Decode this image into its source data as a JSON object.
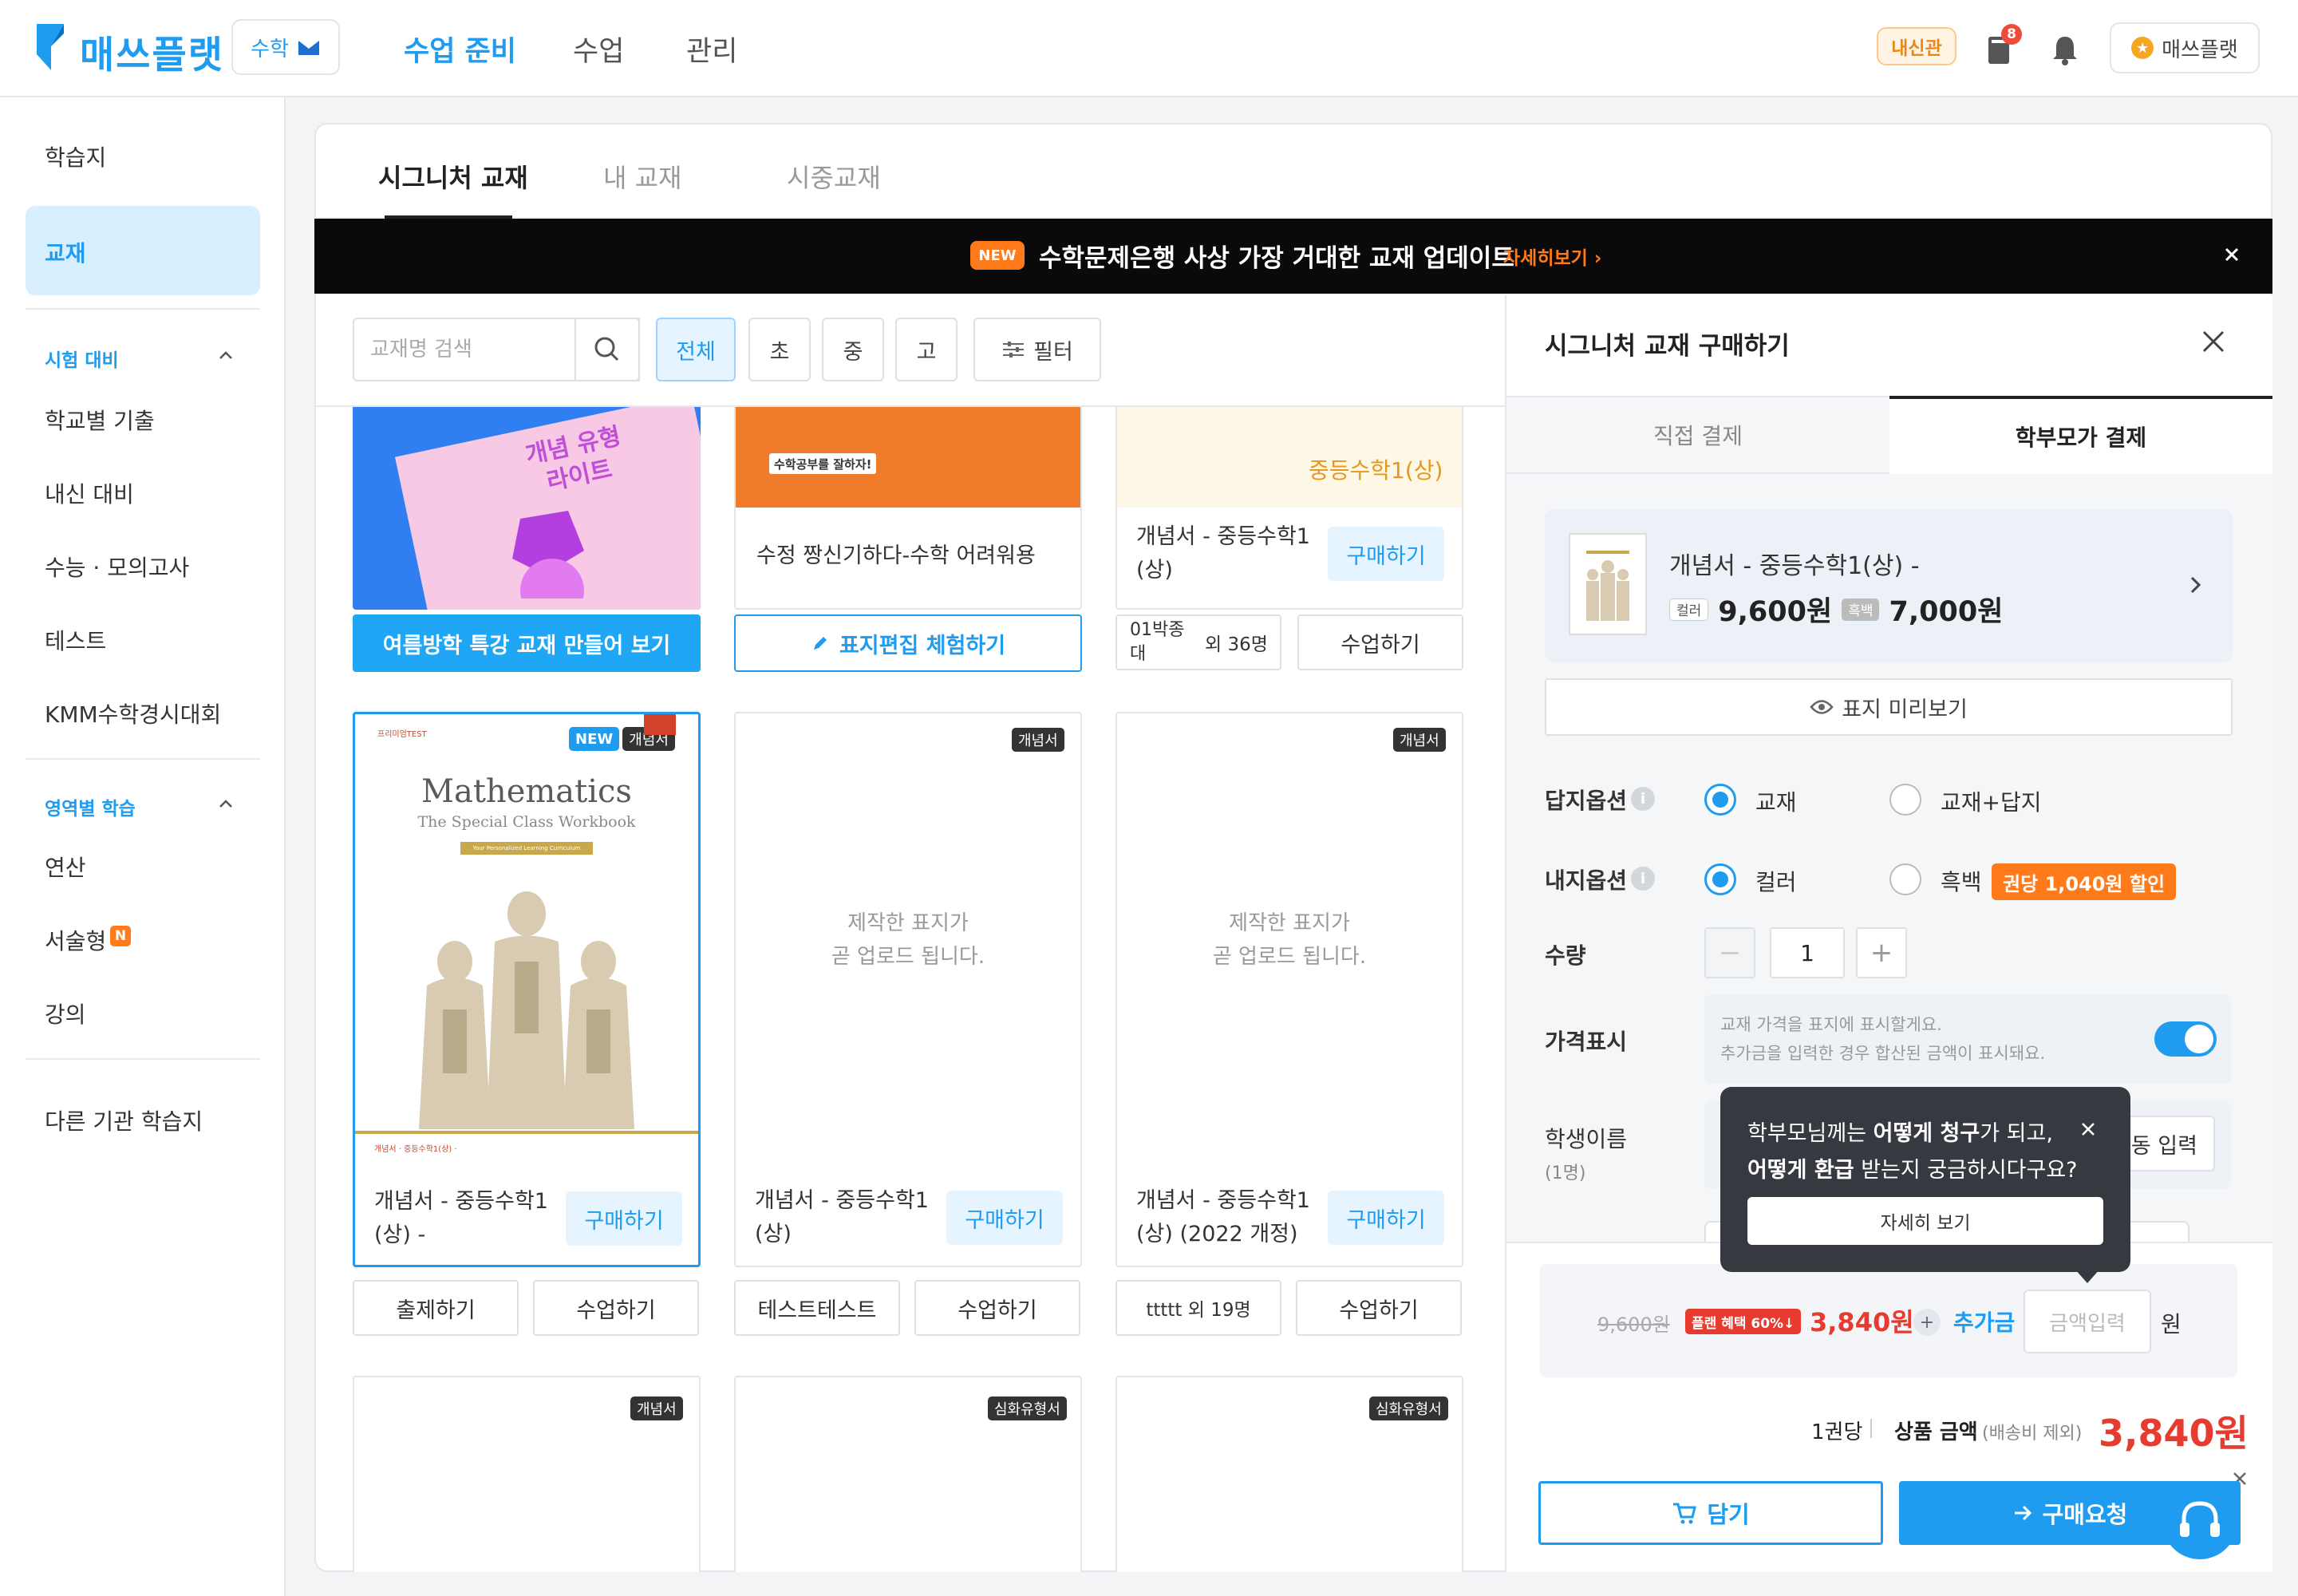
{
  "brand": {
    "logo_text": "매쓰플랫",
    "subject": "수학",
    "accent": "#1f9cf0"
  },
  "nav": {
    "items": [
      "수업 준비",
      "수업",
      "관리"
    ],
    "active": "수업 준비"
  },
  "header": {
    "org_badge": "내신관",
    "notif_count": "8",
    "user_label": "매쓰플랫"
  },
  "sidebar": {
    "items_top": [
      "학습지",
      "교재"
    ],
    "selected": "교재",
    "section_exam": "시험 대비",
    "exam_items": [
      "학교별 기출",
      "내신 대비",
      "수능 · 모의고사",
      "테스트",
      "KMM수학경시대회"
    ],
    "section_area": "영역별 학습",
    "area_items": [
      "연산",
      "서술형",
      "강의"
    ],
    "new_badge": "N",
    "bottom_item": "다른 기관 학습지"
  },
  "tabs": {
    "items": [
      "시그니처 교재",
      "내 교재",
      "시중교재"
    ],
    "active": "시그니처 교재"
  },
  "banner": {
    "badge": "NEW",
    "text": "수학문제은행 사상 가장 거대한 교재 업데이트",
    "link": "자세히보기"
  },
  "filters": {
    "search_placeholder": "교재명 검색",
    "levels": [
      "전체",
      "초",
      "중",
      "고"
    ],
    "active": "전체",
    "filter_label": "필터"
  },
  "top_row": {
    "card1_cover_text": "개념 유형\n라이트",
    "card1_button": "여름방학 특강 교재 만들어 보기",
    "card2_cover_tag": "수학공부를 잘하자!",
    "card2_title": "수정 짱신기하다-수학 어려워용",
    "card2_button": "표지편집 체험하기",
    "card3_cover_text": "중등수학1(상)",
    "card3_title": "개념서 - 중등수학1 (상)",
    "card3_buy": "구매하기",
    "card3_tag": "01박종대",
    "card3_count": "외 36명",
    "card3_class": "수업하기"
  },
  "cards": [
    {
      "tags": [
        "NEW",
        "개념서"
      ],
      "cover_small": "프리미엄TEST",
      "cover_title": "Mathematics",
      "cover_sub": "The Special Class Workbook",
      "cover_band": "Your Personalized Learning Curriculum",
      "cover_foot": "개념서 · 중등수학1(상) ·",
      "title": "개념서 - 중등수학1 (상) -",
      "buy": "구매하기",
      "btn_left": "출제하기",
      "btn_right": "수업하기"
    },
    {
      "tags": [
        "개념서"
      ],
      "placeholder": "제작한 표지가\n곧 업로드 됩니다.",
      "title": "개념서 - 중등수학1 (상)",
      "buy": "구매하기",
      "btn_left": "테스트테스트",
      "btn_right": "수업하기"
    },
    {
      "tags": [
        "개념서"
      ],
      "placeholder": "제작한 표지가\n곧 업로드 됩니다.",
      "title": "개념서 - 중등수학1 (상) (2022 개정)",
      "buy": "구매하기",
      "btn_left": "ttttt 외 19명",
      "btn_right": "수업하기"
    }
  ],
  "bottom_tags": [
    "개념서",
    "심화유형서",
    "심화유형서"
  ],
  "panel": {
    "title": "시그니처 교재 구매하기",
    "tabs": [
      "직접 결제",
      "학부모가 결제"
    ],
    "active_tab": "학부모가 결제",
    "product": {
      "name": "개념서 - 중등수학1(상) -",
      "color_chip": "컬러",
      "color_price": "9,600원",
      "bw_chip": "흑백",
      "bw_price": "7,000원"
    },
    "preview_btn": "표지 미리보기",
    "answer_label": "답지옵션",
    "answer_opts": [
      "교재",
      "교재+답지"
    ],
    "inner_label": "내지옵션",
    "inner_opts": [
      "컬러",
      "흑백"
    ],
    "discount": "권당 1,040원 할인",
    "qty_label": "수량",
    "qty": "1",
    "minus": "−",
    "plus_sym": "+",
    "price_label": "가격표시",
    "price_note1": "교재 가격을 표지에 표시할게요.",
    "price_note2": "추가금을 입력한 경우 합산된 금액이 표시돼요.",
    "student_label": "학생이름",
    "student_count": "(1명)",
    "auto_btn": "자동 입력",
    "orig": "9,600원",
    "promo": "플랜 혜택 60%↓",
    "promo_price": "3,840원",
    "plus": "+",
    "add_label": "추가금",
    "amount_placeholder": "금액입력",
    "won": "원",
    "per": "1권당",
    "sum_label": "상품 금액",
    "sum_note": "(배송비 제외)",
    "sum_price": "3,840원",
    "cart_btn": "담기",
    "req_btn": "구매요청"
  },
  "tooltip": {
    "line1_a": "학부모님께는 ",
    "line1_b": "어떻게 청구",
    "line1_c": "가 되고,",
    "line2_a": "어떻게 환급",
    "line2_b": " 받는지 궁금하시다구요?",
    "btn": "자세히 보기"
  }
}
